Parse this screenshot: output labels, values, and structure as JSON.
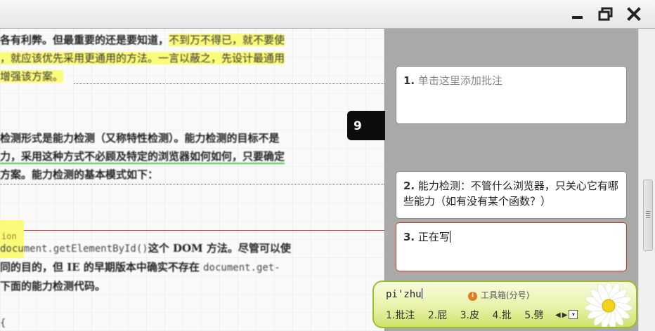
{
  "window": {
    "minimize_icon": "minimize-icon",
    "maximize_icon": "restore-icon",
    "close_icon": "close-icon"
  },
  "document": {
    "para1": {
      "line1_plain": "各有利弊。但最重要的还是要知道，",
      "line1_hl": "不到万不得已，就不要使",
      "line2_hl": "，就应该优先采用更通用的方法。一言以蔽之，先设计最通用",
      "line3_hl": "增强该方案。"
    },
    "para2": {
      "line1": "检测形式是能力检测（又称特性检测）。能力检测的目标不是",
      "line2": "力，采用这种方式不必顾及特定的浏览器如何如何，只要确定",
      "line3": "方案。能力检测的基本模式如下："
    },
    "code_hl": "ion",
    "para3": {
      "line1_code": "document.getElementById()",
      "line1_rest": "这个 DOM 方法。尽管可以使",
      "line2_plain": "同的目的，但 IE 的早期版本中确实不存在 ",
      "line2_code": "document.get-",
      "line3": "下面的能力检测代码。"
    },
    "code_end": "{"
  },
  "page_tab": "9",
  "comments": [
    {
      "number": "1.",
      "text": "单击这里添加批注",
      "state": "placeholder"
    },
    {
      "number": "2.",
      "text": "能力检测：不管什么浏览器，只关心它有哪些能力（如有没有某个函数？）",
      "state": "filled"
    },
    {
      "number": "3.",
      "text": "正在写",
      "state": "editing"
    }
  ],
  "ime": {
    "input": "pi'zhu",
    "toolbox": "工具箱(分号)",
    "candidates": [
      "1.批注",
      "2.屁",
      "3.皮",
      "4.批",
      "5.劈"
    ],
    "accent": "#9abf2d"
  }
}
